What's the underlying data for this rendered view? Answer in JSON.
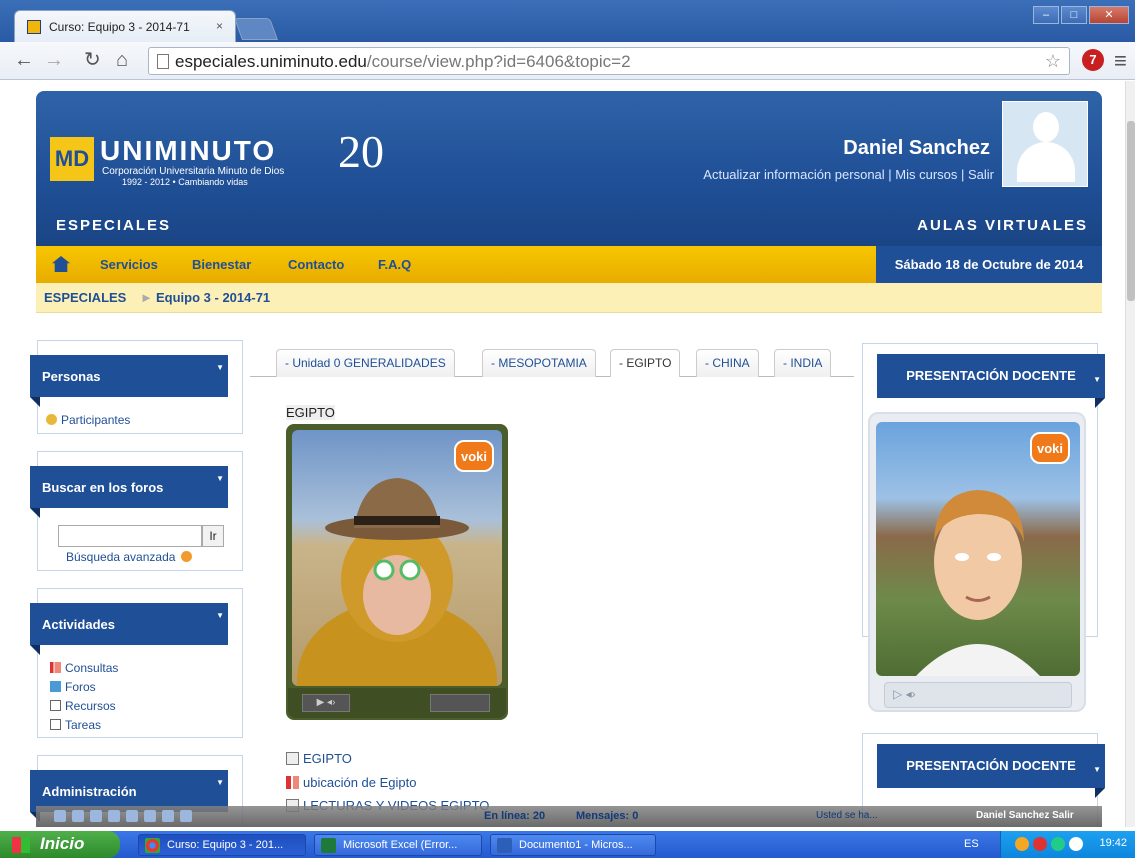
{
  "browser": {
    "tab_title": "Curso: Equipo 3 - 2014-71",
    "tab_close": "×",
    "url_host": "especiales.uniminuto.edu",
    "url_path": "/course/view.php?id=6406&topic=2",
    "ext_badge": "7"
  },
  "header": {
    "logo_name": "UNIMINUTO",
    "logo_sub1": "Corporación Universitaria Minuto de Dios",
    "logo_sub2": "1992 - 2012  •  Cambiando vidas",
    "logo_anniversary": "20",
    "user_name": "Daniel Sanchez",
    "user_links": "Actualizar información personal  |  Mis cursos  |  Salir",
    "left_tagline": "ESPECIALES",
    "right_tagline": "AULAS VIRTUALES"
  },
  "navbar": {
    "items": [
      "Servicios",
      "Bienestar",
      "Contacto",
      "F.A.Q"
    ],
    "date": "Sábado 18 de Octubre de 2014"
  },
  "breadcrumb": {
    "root": "ESPECIALES",
    "separator": "►",
    "current": "Equipo 3 - 2014-71"
  },
  "sidebar": {
    "personas": {
      "title": "Personas",
      "items": [
        "Participantes"
      ]
    },
    "buscar": {
      "title": "Buscar en los foros",
      "button": "Ir",
      "advanced": "Búsqueda avanzada",
      "input_value": ""
    },
    "actividades": {
      "title": "Actividades",
      "items": [
        "Consultas",
        "Foros",
        "Recursos",
        "Tareas"
      ]
    },
    "administracion": {
      "title": "Administración"
    }
  },
  "course_tabs": [
    "- Unidad 0 GENERALIDADES",
    "- MESOPOTAMIA",
    "- EGIPTO",
    "- CHINA",
    "- INDIA"
  ],
  "active_tab": "- EGIPTO",
  "section": {
    "label": "EGIPTO",
    "voki_badge": "voki",
    "resources": [
      "EGIPTO",
      "ubicación de Egipto",
      "LECTURAS Y VIDEOS EGIPTO"
    ]
  },
  "right": {
    "block1_title": "PRESENTACIÓN DOCENTE",
    "block2_title": "PRESENTACIÓN DOCENTE",
    "voki_badge": "voki"
  },
  "dock": {
    "online": "En línea: 20",
    "messages": "Mensajes: 0",
    "notice": "Usted se ha...",
    "user": "Daniel Sanchez  Salir"
  },
  "taskbar": {
    "start": "Inicio",
    "tasks": [
      "Curso: Equipo 3 - 201...",
      "Microsoft Excel (Error...",
      "Documento1 - Micros..."
    ],
    "lang": "ES",
    "clock": "19:42"
  },
  "colors": {
    "brand_blue": "#1f4f96",
    "brand_yellow": "#f7c600",
    "cream": "#fdf0b6"
  }
}
